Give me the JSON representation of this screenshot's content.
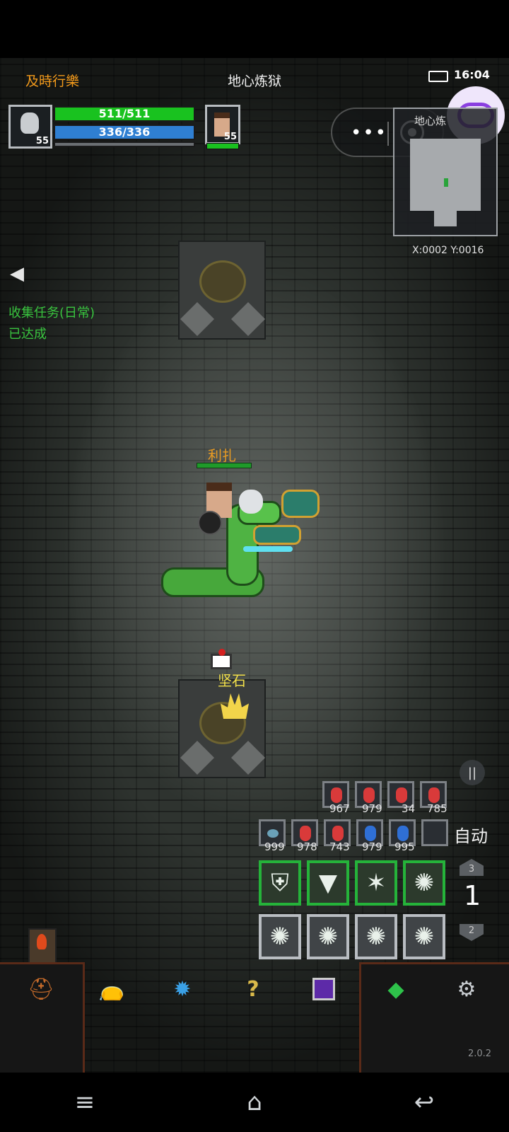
{
  "hud": {
    "guild_name": "及時行樂",
    "map_name": "地心炼狱",
    "time": "16:04",
    "minimap_label": "地心炼",
    "coords": "X:0002 Y:0016",
    "player": {
      "hp": "511/511",
      "mp": "336/336",
      "level": "55",
      "hp_fraction": 1.0,
      "mp_fraction": 1.0
    },
    "companion": {
      "level": "55",
      "hp_fraction": 1.0
    }
  },
  "quest": {
    "title": "收集任务(日常)",
    "status": "已达成"
  },
  "world": {
    "npc_name": "利扎",
    "item_name": "坚石"
  },
  "potions": {
    "row1": [
      "967",
      "979",
      "34",
      "785"
    ],
    "row2": [
      "999",
      "978",
      "743",
      "979",
      "995"
    ]
  },
  "controls": {
    "auto_label": "自动",
    "page_current": "1",
    "page_up": "3",
    "page_down": "2"
  },
  "version": "2.0.2",
  "icons": {
    "back": "back-arrow-icon",
    "menu": [
      "helmet-icon",
      "bag-icon",
      "crystal-icon",
      "help-icon",
      "book-icon",
      "gem-icon",
      "settings-icon"
    ],
    "nav": [
      "menu-icon",
      "home-icon",
      "back-icon"
    ]
  },
  "colors": {
    "hp": "#19c21f",
    "mp": "#2f7fd2",
    "orange_text": "#f39a1b",
    "quest_green": "#39c43f",
    "skill_green": "#25b33a"
  }
}
